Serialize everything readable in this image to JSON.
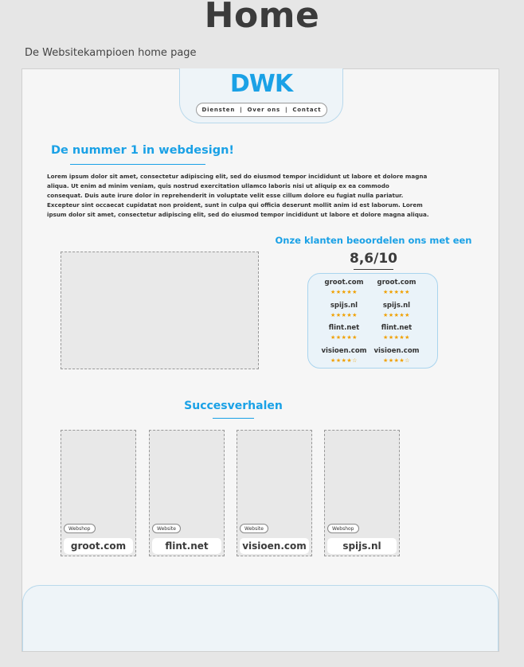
{
  "page": {
    "title": "Home",
    "caption": "De Websitekampioen home page"
  },
  "header": {
    "logo": "DWK",
    "nav": [
      "Diensten",
      "Over ons",
      "Contact"
    ]
  },
  "hero": {
    "title": "De nummer 1 in webdesign!",
    "body_lines": [
      "Lorem ipsum dolor sit amet, consectetur adipiscing elit, sed do eiusmod tempor incididunt ut labore et dolore magna",
      "aliqua. Ut enim ad minim veniam, quis nostrud exercitation ullamco laboris nisi ut aliquip ex ea commodo",
      "consequat. Duis aute irure dolor in reprehenderit in voluptate velit esse cillum dolore eu fugiat nulla pariatur.",
      "Excepteur sint occaecat cupidatat non proident, sunt in culpa qui officia deserunt mollit anim id est laborum. Lorem",
      "ipsum dolor sit amet, consectetur adipiscing elit, sed do eiusmod tempor incididunt ut labore et dolore magna aliqua."
    ]
  },
  "ratings": {
    "title": "Onze klanten beoordelen ons met een",
    "score": "8,6/10",
    "reviews": [
      {
        "site": "groot.com",
        "stars": "★★★★★"
      },
      {
        "site": "groot.com",
        "stars": "★★★★★"
      },
      {
        "site": "spijs.nl",
        "stars": "★★★★★"
      },
      {
        "site": "spijs.nl",
        "stars": "★★★★★"
      },
      {
        "site": "flint.net",
        "stars": "★★★★★"
      },
      {
        "site": "flint.net",
        "stars": "★★★★★"
      },
      {
        "site": "visioen.com",
        "stars": "★★★★☆"
      },
      {
        "site": "visioen.com",
        "stars": "★★★★☆"
      }
    ]
  },
  "success": {
    "title": "Succesverhalen",
    "cases": [
      {
        "badge": "Webshop",
        "name": "groot.com"
      },
      {
        "badge": "Website",
        "name": "flint.net"
      },
      {
        "badge": "Website",
        "name": "visioen.com"
      },
      {
        "badge": "Webshop",
        "name": "spijs.nl"
      }
    ]
  },
  "colors": {
    "accent": "#1aa1e6",
    "star": "#f0a000",
    "text": "#3b3b3b"
  }
}
